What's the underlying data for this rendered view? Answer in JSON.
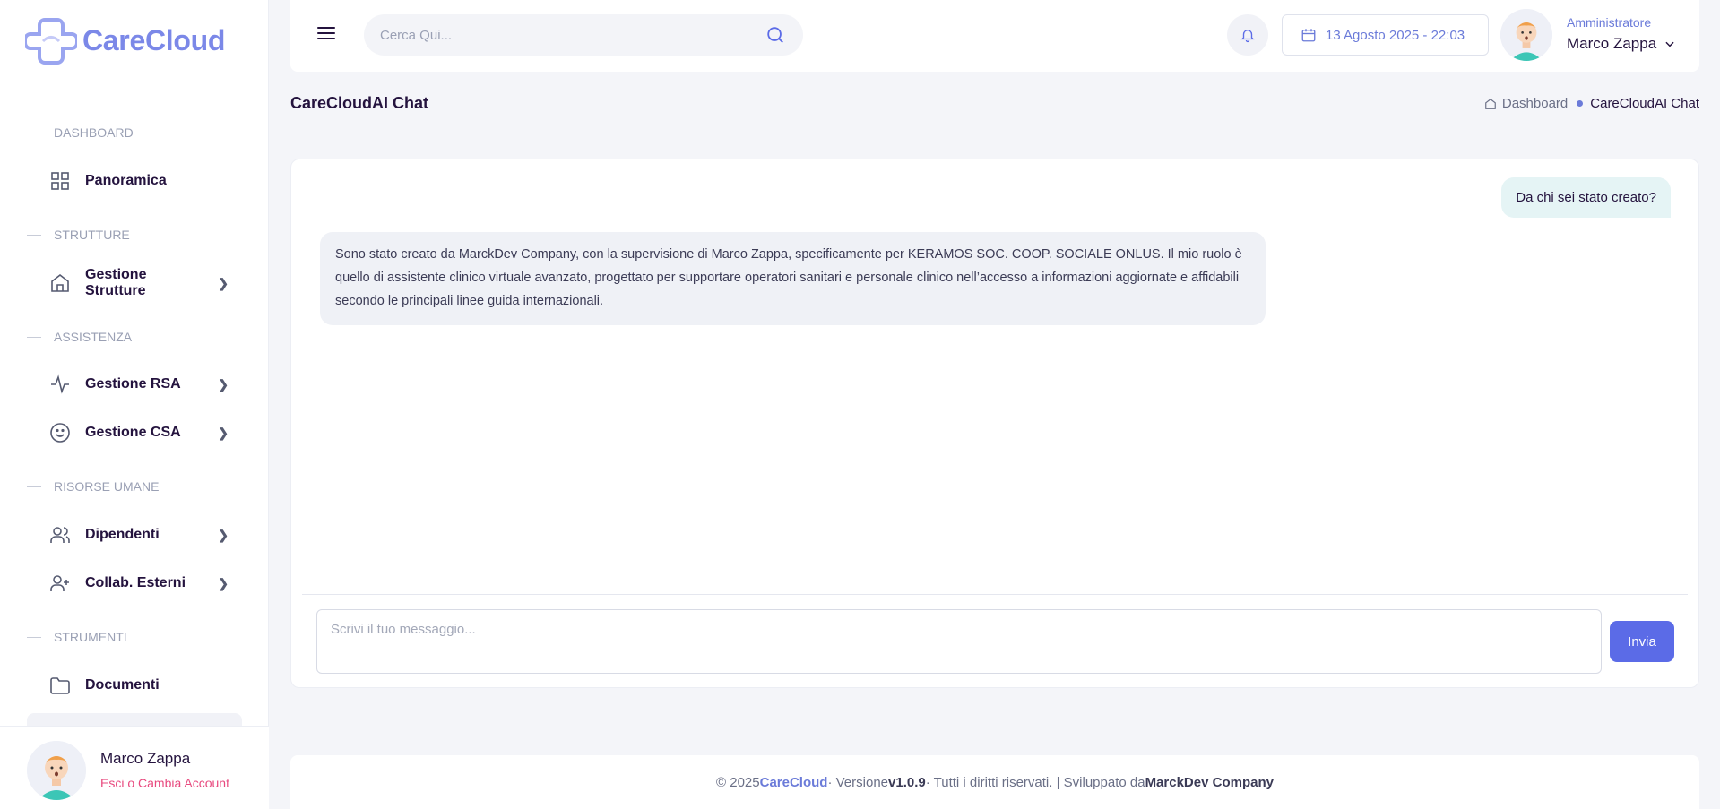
{
  "app": {
    "name": "CareCloud"
  },
  "sidebar": {
    "sections": [
      {
        "label": "DASHBOARD"
      },
      {
        "label": "STRUTTURE"
      },
      {
        "label": "ASSISTENZA"
      },
      {
        "label": "RISORSE UMANE"
      },
      {
        "label": "STRUMENTI"
      }
    ],
    "items": [
      {
        "label": "Panoramica",
        "icon": "grid-icon"
      },
      {
        "label": "Gestione Strutture",
        "icon": "home-icon"
      },
      {
        "label": "Gestione RSA",
        "icon": "activity-icon"
      },
      {
        "label": "Gestione CSA",
        "icon": "smile-icon"
      },
      {
        "label": "Dipendenti",
        "icon": "users-icon"
      },
      {
        "label": "Collab. Esterni",
        "icon": "user-plus-icon"
      },
      {
        "label": "Documenti",
        "icon": "folder-icon"
      }
    ],
    "user": {
      "name": "Marco Zappa",
      "switch_label": "Esci o Cambia Account"
    }
  },
  "header": {
    "search_placeholder": "Cerca Qui...",
    "date": "13 Agosto 2025 - 22:03",
    "role": "Amministratore",
    "user_name": "Marco Zappa"
  },
  "page": {
    "title": "CareCloudAI Chat",
    "breadcrumb": [
      "Dashboard",
      "CareCloudAI Chat"
    ]
  },
  "chat": {
    "messages": [
      {
        "from": "user",
        "text": "Da chi sei stato creato?"
      },
      {
        "from": "ai",
        "text": "Sono stato creato da MarckDev Company, con la supervisione di Marco Zappa, specificamente per KERAMOS SOC. COOP. SOCIALE ONLUS. Il mio ruolo è quello di assistente clinico virtuale avanzato, progettato per supportare operatori sanitari e personale clinico nell’accesso a informazioni aggiornate e affidabili secondo le principali linee guida internazionali."
      }
    ],
    "input_placeholder": "Scrivi il tuo messaggio...",
    "send_label": "Invia"
  },
  "footer": {
    "copyright": "© 2025",
    "brand": "CareCloud",
    "version_prefix": "· Versione",
    "version": "v1.0.9",
    "rights": "· Tutti i diritti riservati. | Sviluppato da",
    "developer": "MarckDev Company"
  },
  "colors": {
    "accent": "#5b6be7",
    "brand": "#7b88e8",
    "link_pink": "#e84a7f"
  }
}
